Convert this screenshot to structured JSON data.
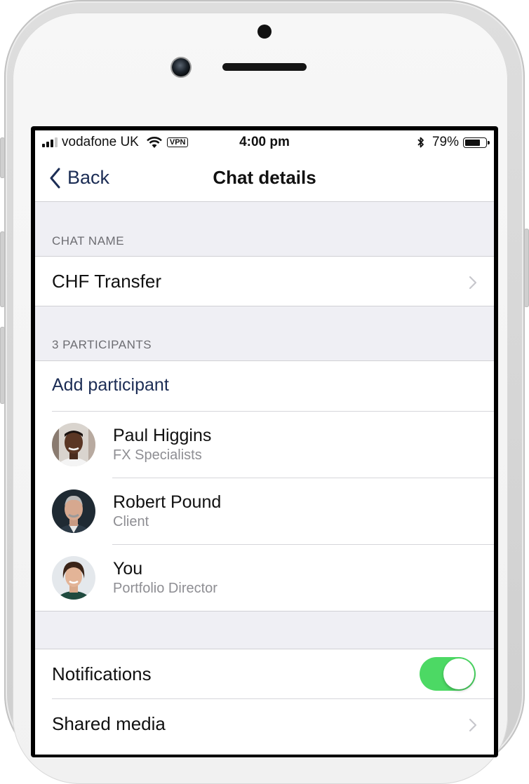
{
  "status_bar": {
    "carrier": "vodafone UK",
    "vpn": "VPN",
    "time": "4:00 pm",
    "battery_percent": "79%",
    "battery_level": 0.79,
    "signal_bars": 3,
    "signal_total": 4,
    "icons": [
      "signal-icon",
      "wifi-icon",
      "bluetooth-icon",
      "battery-icon"
    ]
  },
  "nav": {
    "back_label": "Back",
    "title": "Chat details"
  },
  "chat_name_section": {
    "header": "CHAT NAME",
    "value": "CHF Transfer"
  },
  "participants_section": {
    "header": "3 PARTICIPANTS",
    "add_label": "Add participant",
    "participants": [
      {
        "name": "Paul Higgins",
        "role": "FX Specialists"
      },
      {
        "name": "Robert Pound",
        "role": "Client"
      },
      {
        "name": "You",
        "role": "Portfolio Director"
      }
    ]
  },
  "settings_section": {
    "notifications_label": "Notifications",
    "notifications_on": true,
    "shared_media_label": "Shared media"
  },
  "colors": {
    "accent": "#1c2d55",
    "toggle_on": "#4cd964",
    "grouped_background": "#efeff4"
  }
}
